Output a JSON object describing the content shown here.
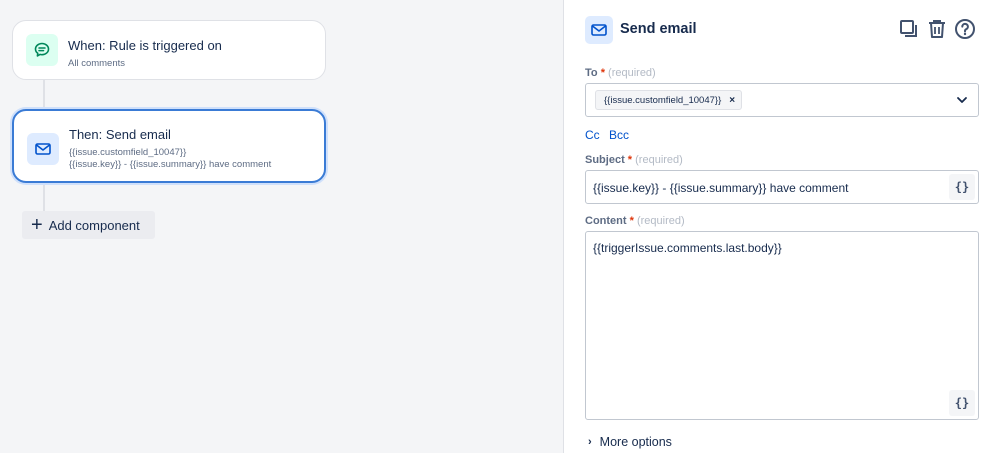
{
  "canvas": {
    "trigger": {
      "title": "When: Rule is triggered on",
      "subtitle": "All comments",
      "icon": "comment-icon"
    },
    "action": {
      "title": "Then: Send email",
      "line1": "{{issue.customfield_10047}}",
      "line2": "{{issue.key}} - {{issue.summary}} have comment",
      "icon": "mail-icon"
    },
    "add_component_label": "Add component"
  },
  "panel": {
    "title": "Send email",
    "icon": "mail-icon",
    "tools": [
      "duplicate-icon",
      "trash-icon",
      "help-icon"
    ],
    "to": {
      "label": "To",
      "required_mark": "*",
      "required_text": "(required)",
      "chip": "{{issue.customfield_10047}}",
      "chip_remove": "×"
    },
    "cc_label": "Cc",
    "bcc_label": "Bcc",
    "subject": {
      "label": "Subject",
      "required_mark": "*",
      "required_text": "(required)",
      "value": "{{issue.key}} - {{issue.summary}} have comment",
      "smart_value_button": "{}"
    },
    "content": {
      "label": "Content",
      "required_mark": "*",
      "required_text": "(required)",
      "value": "{{triggerIssue.comments.last.body}}",
      "smart_value_button": "{}"
    },
    "more_options_label": "More options"
  },
  "colors": {
    "accent": "#0052cc",
    "selected_border": "#3a7bd5",
    "trigger_icon_bg": "#dcfff1",
    "trigger_icon": "#00875a",
    "action_icon_bg": "#deebff",
    "action_icon": "#0052cc",
    "required_star": "#de350b"
  }
}
